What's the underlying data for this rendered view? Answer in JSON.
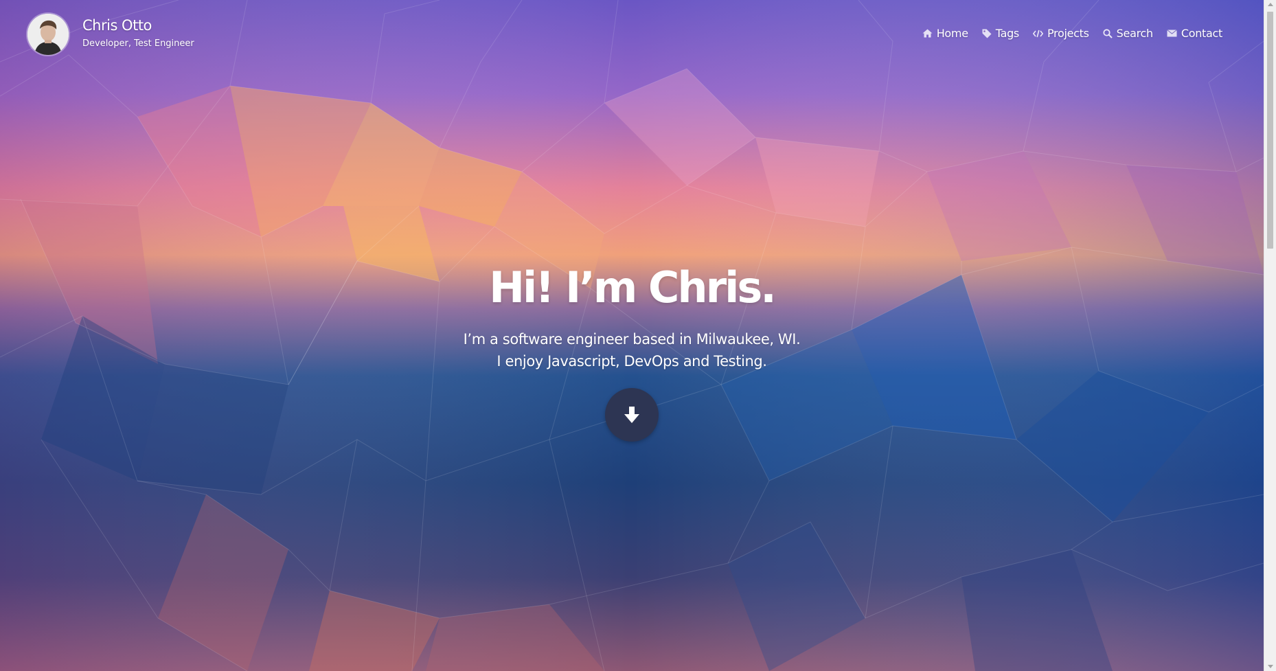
{
  "header": {
    "name": "Chris Otto",
    "tagline": "Developer, Test Engineer"
  },
  "nav": {
    "items": [
      {
        "label": "Home",
        "icon": "home-icon"
      },
      {
        "label": "Tags",
        "icon": "tag-icon"
      },
      {
        "label": "Projects",
        "icon": "code-icon"
      },
      {
        "label": "Search",
        "icon": "search-icon"
      },
      {
        "label": "Contact",
        "icon": "envelope-icon"
      }
    ]
  },
  "hero": {
    "title": "Hi! I’m Chris.",
    "line1": "I’m a software engineer based in Milwaukee, WI.",
    "line2": "I enjoy Javascript, DevOps and Testing.",
    "scroll_icon": "arrow-down-icon"
  },
  "colors": {
    "text": "#ffffff",
    "scroll_button": "#2d3553",
    "background_top": "#7a5cc2",
    "background_middle": "#f6a56d",
    "background_bottom": "#1f3d78"
  }
}
